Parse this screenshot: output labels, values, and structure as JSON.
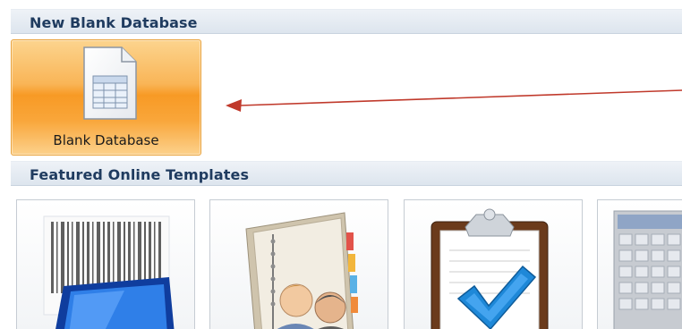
{
  "sections": {
    "new_blank": {
      "title": "New Blank Database",
      "tile_label": "Blank Database"
    },
    "featured": {
      "title": "Featured Online Templates"
    }
  },
  "icons": {
    "blank_tile": "database-document-icon",
    "tile_1": "barcode-monitor-icon",
    "tile_2": "address-book-contacts-icon",
    "tile_3": "clipboard-checkmark-icon",
    "tile_4": "calendar-grid-icon"
  },
  "colors": {
    "header_text": "#1f3b5f",
    "selected_tile": "#f79a25",
    "arrow": "#c0392b"
  }
}
